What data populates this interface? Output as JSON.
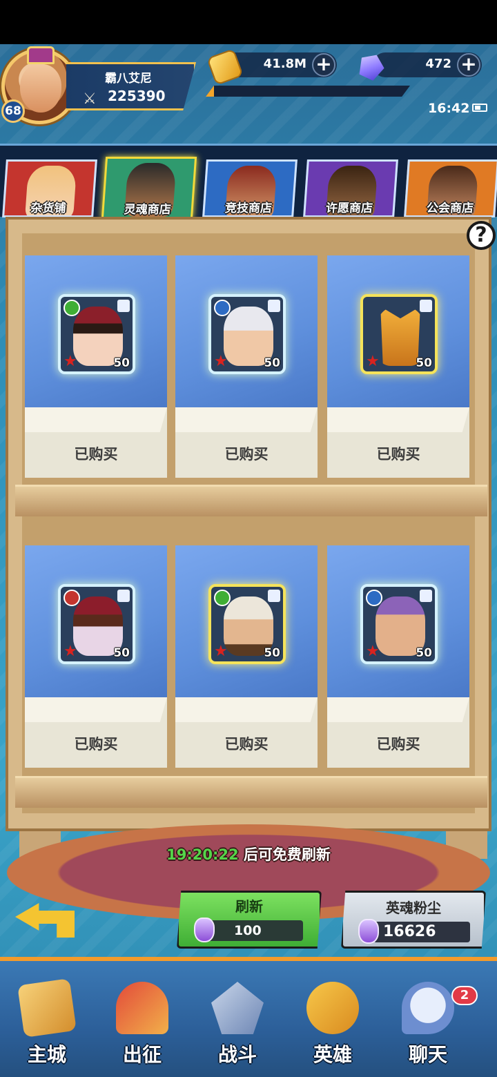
{
  "player": {
    "name": "霸八艾尼",
    "power": "225390",
    "level": "68"
  },
  "resources": {
    "gold": "41.8M",
    "gems": "472",
    "gold_plus": "+",
    "gem_plus": "+",
    "exp_progress": 0.04
  },
  "status": {
    "time": "16:42"
  },
  "tabs": [
    {
      "label": "杂货铺",
      "active": false
    },
    {
      "label": "灵魂商店",
      "active": true
    },
    {
      "label": "竞技商店",
      "active": false
    },
    {
      "label": "许愿商店",
      "active": false
    },
    {
      "label": "公会商店",
      "active": false
    }
  ],
  "help_label": "?",
  "cards": [
    {
      "level": "50",
      "status": "已购买"
    },
    {
      "level": "50",
      "status": "已购买"
    },
    {
      "level": "50",
      "status": "已购买"
    },
    {
      "level": "50",
      "status": "已购买"
    },
    {
      "level": "50",
      "status": "已购买"
    },
    {
      "level": "50",
      "status": "已购买"
    }
  ],
  "refresh_timer": {
    "time": "19:20:22",
    "suffix": " 后可免费刷新"
  },
  "refresh_button": {
    "label": "刷新",
    "cost": "100"
  },
  "dust": {
    "title": "英魂粉尘",
    "value": "16626"
  },
  "nav": [
    {
      "label": "主城"
    },
    {
      "label": "出征"
    },
    {
      "label": "战斗"
    },
    {
      "label": "英雄"
    },
    {
      "label": "聊天"
    }
  ],
  "chat_badge": "2"
}
